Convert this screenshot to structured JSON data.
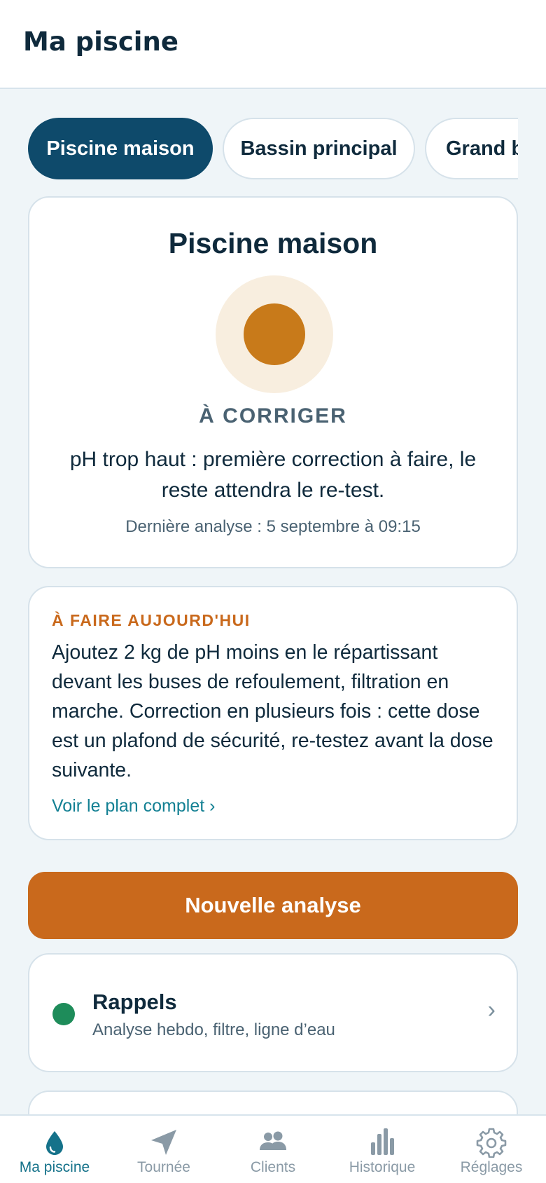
{
  "header": {
    "title": "Ma piscine"
  },
  "pools": {
    "tabs": [
      {
        "label": "Piscine maison",
        "active": true
      },
      {
        "label": "Bassin principal",
        "active": false
      },
      {
        "label": "Grand bassin",
        "active": false
      }
    ]
  },
  "status": {
    "pool_name": "Piscine maison",
    "label": "À CORRIGER",
    "message": "pH trop haut : première correction à faire, le reste attendra le re-test.",
    "last_analysis": "Dernière analyse : 5 septembre à 09:15",
    "color": "#c87a1a",
    "halo_color": "#f8eedf"
  },
  "todo": {
    "heading": "À FAIRE AUJOURD'HUI",
    "text": "Ajoutez 2 kg de pH moins en le répartissant devant les buses de refoulement, filtration en marche. Correction en plusieurs fois : cette dose est un plafond de sécurité, re-testez avant la dose suivante.",
    "link": "Voir le plan complet ›"
  },
  "actions": {
    "new_analysis": "Nouvelle analyse"
  },
  "reminders": {
    "title": "Rappels",
    "subtitle": "Analyse hebdo, filtre, ligne d’eau",
    "chevron": "›",
    "dot_color": "#1e8c5a"
  },
  "nav": {
    "items": [
      {
        "label": "Ma piscine",
        "icon": "water-drop-icon",
        "active": true
      },
      {
        "label": "Tournée",
        "icon": "navigation-arrow-icon",
        "active": false
      },
      {
        "label": "Clients",
        "icon": "people-icon",
        "active": false
      },
      {
        "label": "Historique",
        "icon": "bar-chart-icon",
        "active": false
      },
      {
        "label": "Réglages",
        "icon": "gear-icon",
        "active": false
      }
    ]
  },
  "colors": {
    "primary": "#0e4a6b",
    "accent": "#c9691c",
    "link": "#138093",
    "background": "#eff5f8"
  }
}
